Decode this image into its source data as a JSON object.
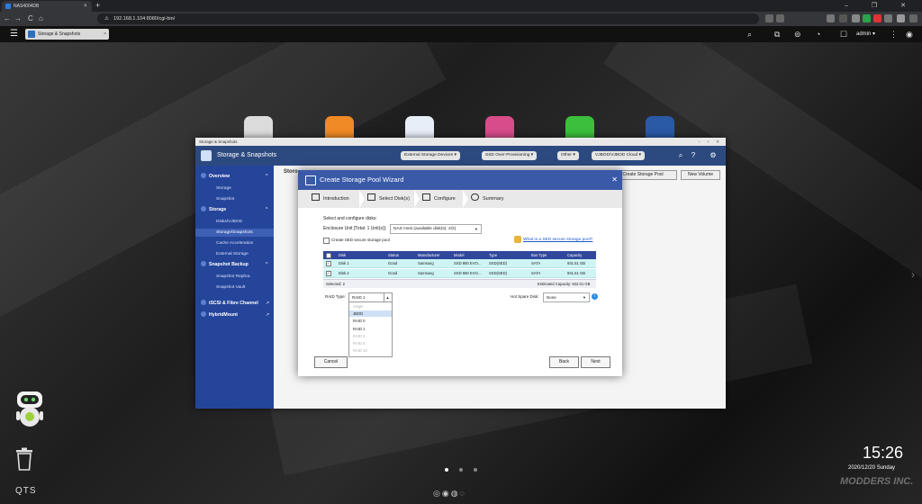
{
  "browser": {
    "tab_title": "NAS4004DB",
    "tab_close": "×",
    "new_tab": "+",
    "window_controls": "– ❐ ✕",
    "back": "←",
    "forward": "→",
    "reload": "C",
    "home": "⌂",
    "url_lock": "⚠",
    "url": "192.168.1.104:8080/cgi-bin/"
  },
  "qts_bar": {
    "menu_icon": "☰",
    "app_tab_label": "Storage & Snapshots",
    "app_tab_close": "×",
    "user": "admin ▾",
    "more": "⋮"
  },
  "window": {
    "title": "Storage & Snapshots",
    "controls": "– + ✕",
    "header_title": "Storage & Snapshots",
    "header_buttons": [
      "External Storage Devices ▾",
      "SSD Over-Provisioning ▾",
      "Other ▾",
      "VJBOD/VJBOD Cloud ▾"
    ],
    "sidebar": [
      {
        "type": "group",
        "label": "Overview",
        "chev": "^"
      },
      {
        "type": "item",
        "label": "Storage"
      },
      {
        "type": "item",
        "label": "Snapshot"
      },
      {
        "type": "group",
        "label": "Storage",
        "chev": "^"
      },
      {
        "type": "item",
        "label": "Disks/VJBOD"
      },
      {
        "type": "item",
        "label": "Storage/Snapshots",
        "selected": true
      },
      {
        "type": "item",
        "label": "Cache Acceleration"
      },
      {
        "type": "item",
        "label": "External Storage"
      },
      {
        "type": "group",
        "label": "Snapshot Backup",
        "chev": "^"
      },
      {
        "type": "item",
        "label": "Snapshot Replica"
      },
      {
        "type": "item",
        "label": "Snapshot Vault"
      },
      {
        "type": "group",
        "label": "iSCSI & Fibre Channel",
        "chev": "↗"
      },
      {
        "type": "group",
        "label": "HybridMount",
        "chev": "↗"
      }
    ],
    "content_label": "Storo",
    "create_pool_button": "Create Storage Pool",
    "new_volume_button": "New Volume"
  },
  "dialog": {
    "title": "Create Storage Pool Wizard",
    "close": "✕",
    "steps": [
      "Introduction",
      "Select Disk(s)",
      "Configure",
      "Summary"
    ],
    "select_heading": "Select and configure disks:",
    "enclosure_label": "Enclosure Unit [Total: 1 Unit(s)]:",
    "enclosure_value": "NAS Host (available disk(s): 2/2)",
    "sed_checkbox_label": "Create SED secure storage pool",
    "sed_link": "What is a SED secure storage pool?",
    "table": {
      "headers": [
        "Disk",
        "Status",
        "Manufacturer",
        "Model",
        "Type",
        "Bus Type",
        "Capacity"
      ],
      "rows": [
        {
          "checked": true,
          "cells": [
            "Disk 1",
            "Good",
            "Samsung",
            "SSD 860 EVO...",
            "SSD(SED)",
            "SATA",
            "931.51 GB"
          ]
        },
        {
          "checked": true,
          "cells": [
            "Disk 2",
            "Good",
            "Samsung",
            "SSD 860 EVO...",
            "SSD(SED)",
            "SATA",
            "931.51 GB"
          ]
        }
      ],
      "footer_left": "Selected: 2",
      "footer_right": "Estimated Capacity: 922.01 GB"
    },
    "raid_label": "RAID Type:",
    "raid_value": "RAID 1",
    "raid_options": [
      {
        "label": "Single",
        "disabled": true
      },
      {
        "label": "JBOD",
        "disabled": false,
        "highlight": true
      },
      {
        "label": "RAID 0",
        "disabled": false
      },
      {
        "label": "RAID 1",
        "disabled": false
      },
      {
        "label": "RAID 5",
        "disabled": true
      },
      {
        "label": "RAID 6",
        "disabled": true
      },
      {
        "label": "RAID 10",
        "disabled": true
      }
    ],
    "hot_spare_label": "Hot Spare Disk:",
    "hot_spare_value": "None",
    "info_icon": "i",
    "cancel": "Cancel",
    "back": "Back",
    "next": "Next"
  },
  "desktop": {
    "time": "15:26",
    "date": "2020/12/20 Sunday",
    "brand": "QTS",
    "watermark": "MODDERS INC.",
    "page_dots": 3,
    "active_dot": 0,
    "dock": "◎◉◍◌"
  },
  "colors": {
    "accent": "#2d4a80",
    "sidebar": "#25459b",
    "dialog_header": "#3a59a8",
    "table_header": "#30479c",
    "row_selected": "#cff4f4"
  }
}
